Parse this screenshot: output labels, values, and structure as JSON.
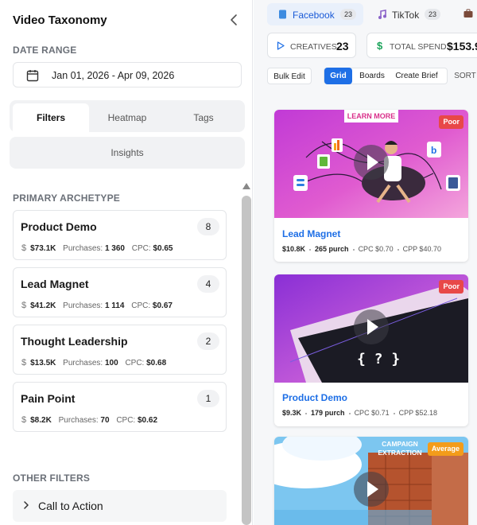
{
  "sidebar": {
    "title": "Video Taxonomy",
    "date_range_label": "DATE RANGE",
    "date_range_value": "Jan 01, 2026 - Apr 09, 2026",
    "tabs": [
      "Filters",
      "Heatmap",
      "Tags",
      "Insights"
    ],
    "primary_archetype_label": "PRIMARY ARCHETYPE",
    "archetypes": [
      {
        "name": "Product Demo",
        "count": "8",
        "spend": "$73.1K",
        "purchases_label": "Purchases:",
        "purchases": "1 360",
        "cpc_label": "CPC:",
        "cpc": "$0.65"
      },
      {
        "name": "Lead Magnet",
        "count": "4",
        "spend": "$41.2K",
        "purchases_label": "Purchases:",
        "purchases": "1 114",
        "cpc_label": "CPC:",
        "cpc": "$0.67"
      },
      {
        "name": "Thought Leadership",
        "count": "2",
        "spend": "$13.5K",
        "purchases_label": "Purchases:",
        "purchases": "100",
        "cpc_label": "CPC:",
        "cpc": "$0.68"
      },
      {
        "name": "Pain Point",
        "count": "1",
        "spend": "$8.2K",
        "purchases_label": "Purchases:",
        "purchases": "70",
        "cpc_label": "CPC:",
        "cpc": "$0.62"
      }
    ],
    "other_filters_label": "OTHER FILTERS",
    "call_to_action": "Call to Action"
  },
  "main": {
    "platforms": [
      {
        "label": "Facebook",
        "count": "23"
      },
      {
        "label": "TikTok",
        "count": "23"
      }
    ],
    "metrics": {
      "creatives_label": "CREATIVES",
      "creatives_value": "23",
      "spend_label": "TOTAL SPEND",
      "spend_value": "$153.9"
    },
    "toolbar": {
      "bulk_edit": "Bulk Edit",
      "grid": "Grid",
      "boards": "Boards",
      "create_brief": "Create Brief",
      "sort": "SORT"
    },
    "cards": [
      {
        "title": "Lead Magnet",
        "spend": "$10.8K",
        "purch": "265 purch",
        "cpc": "CPC $0.70",
        "cpp": "CPP $40.70",
        "badge": "Poor",
        "overlay_text": "LEARN MORE"
      },
      {
        "title": "Product Demo",
        "spend": "$9.3K",
        "purch": "179 purch",
        "cpc": "CPC $0.71",
        "cpp": "CPP $52.18",
        "badge": "Poor",
        "overlay_text": "{ ? }"
      },
      {
        "title": "",
        "badge": "Average",
        "overlay_text": "CAMPAIGN EXTRACTION"
      }
    ]
  },
  "colors": {
    "accent": "#1e6fe6",
    "poor": "#e84848",
    "average": "#f39c1a",
    "spend_green": "#1aa35a"
  }
}
